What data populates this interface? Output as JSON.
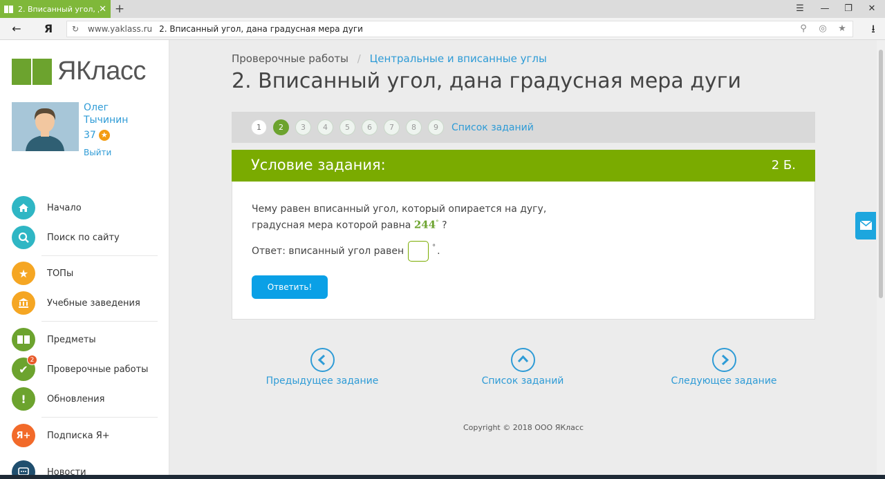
{
  "browser": {
    "tab_title": "2. Вписанный угол, дана градусная мера дуги",
    "new_tab_symbol": "+",
    "back_symbol": "←",
    "yandex_symbol": "Я",
    "url_domain": "www.yaklass.ru",
    "url_title": "2. Вписанный угол, дана градусная мера дуги",
    "window_controls": [
      "☰",
      "—",
      "❐",
      "✕"
    ],
    "download_symbol": "⭳"
  },
  "sidebar": {
    "logo_text": "ЯКласс",
    "user": {
      "first_name": "Олег",
      "last_name": "Тычинин",
      "points": "37",
      "logout": "Выйти"
    },
    "menu": [
      {
        "label": "Начало",
        "icon": "home-icon",
        "color": "#2fb6c4"
      },
      {
        "label": "Поиск по сайту",
        "icon": "search-icon",
        "color": "#2fb6c4"
      },
      {
        "label": "ТОПы",
        "icon": "star-icon",
        "color": "#f5a623"
      },
      {
        "label": "Учебные заведения",
        "icon": "institution-icon",
        "color": "#f5a623"
      },
      {
        "label": "Предметы",
        "icon": "book-icon",
        "color": "#6ca32e"
      },
      {
        "label": "Проверочные работы",
        "icon": "check-icon",
        "color": "#6ca32e",
        "badge": "2"
      },
      {
        "label": "Обновления",
        "icon": "exclamation-icon",
        "color": "#6ca32e"
      },
      {
        "label": "Подписка Я+",
        "icon": "ya-plus-icon",
        "color": "#f26a2a",
        "icon_text": "Я+"
      },
      {
        "label": "Новости",
        "icon": "news-icon",
        "color": "#1f4e6e"
      }
    ]
  },
  "main": {
    "breadcrumb": {
      "first": "Проверочные работы",
      "separator": "/",
      "second": "Центральные и вписанные углы"
    },
    "title": "2. Вписанный угол, дана градусная мера дуги",
    "pager": {
      "pages": [
        "1",
        "2",
        "3",
        "4",
        "5",
        "6",
        "7",
        "8",
        "9"
      ],
      "active": "2",
      "task_list": "Список заданий"
    },
    "task": {
      "header": "Условие задания:",
      "points": "2 Б.",
      "question_line1": "Чему равен вписанный угол, который опирается на дугу,",
      "question_line2": "градусная мера которой равна",
      "arc_value": "244",
      "degree": "°",
      "question_mark": "?",
      "answer_label": "Ответ: вписанный угол равен",
      "answer_value": "",
      "answer_suffix": ".",
      "submit": "Ответить!"
    },
    "nav": {
      "prev": "Предыдущее задание",
      "list": "Список заданий",
      "next": "Следующее задание"
    },
    "copyright": "Copyright © 2018 ООО ЯКласс"
  },
  "colors": {
    "brand_green": "#6ca32e",
    "header_green": "#7aab00",
    "link_blue": "#2e9bd6",
    "button_blue": "#0aa0e6"
  }
}
